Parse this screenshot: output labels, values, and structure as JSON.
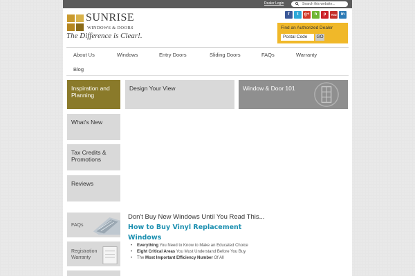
{
  "topbar": {
    "dealer_login": "Dealer Login",
    "search_placeholder": "Search this website..."
  },
  "logo": {
    "name": "SUNRISE",
    "sub": "WINDOWS & DOORS",
    "tagline": "The Difference is Clear!."
  },
  "social": [
    {
      "name": "facebook",
      "glyph": "f",
      "color": "#3b5998"
    },
    {
      "name": "twitter",
      "glyph": "t",
      "color": "#2fa8d8"
    },
    {
      "name": "google-plus",
      "glyph": "g+",
      "color": "#d13b2a"
    },
    {
      "name": "houzz",
      "glyph": "h",
      "color": "#6fb534"
    },
    {
      "name": "pinterest",
      "glyph": "p",
      "color": "#cb2027"
    },
    {
      "name": "youtube",
      "glyph": "You",
      "color": "#c4302b"
    },
    {
      "name": "linkedin",
      "glyph": "in",
      "color": "#2d7bb6"
    }
  ],
  "dealer": {
    "title": "Find an Authorized Dealer",
    "postal_placeholder": "Postal Code",
    "go": "GO"
  },
  "nav": [
    "About Us",
    "Windows",
    "Entry Doors",
    "Sliding Doors",
    "FAQs",
    "Warranty",
    "Blog"
  ],
  "tiles": {
    "inspiration": "Inspiration and Planning",
    "design": "Design Your View",
    "window101": "Window & Door 101",
    "whats_new": "What's New",
    "tax": "Tax Credits & Promotions",
    "reviews": "Reviews"
  },
  "small_tiles": {
    "faqs": "FAQs",
    "registration": "Registration Warranty"
  },
  "article": {
    "headline": "Don't Buy New Windows Until You Read This...",
    "subhead_line1": "How to Buy Vinyl Replacement",
    "subhead_line2": "Windows",
    "bullets": [
      {
        "bold": "Everything",
        "rest": " You Need to Know to Make an Educated Choice"
      },
      {
        "bold": "Eight Critical Areas",
        "rest": " You Must Understand Before You Buy"
      },
      {
        "pre": "The ",
        "bold": "Most Important Efficiency Number",
        "rest": " Of All"
      }
    ]
  },
  "colors": {
    "accent_olive": "#8a7a2a",
    "link_blue": "#1b8fb0",
    "dealer_yellow": "#f0b829"
  }
}
